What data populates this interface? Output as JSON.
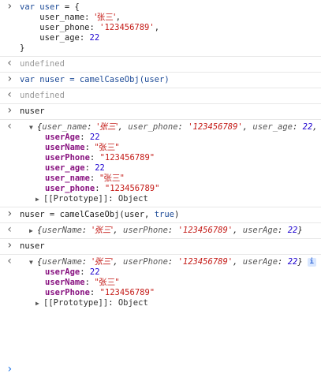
{
  "entries": [
    {
      "type": "input",
      "code_lines": [
        [
          "var ",
          "user",
          " = {"
        ],
        [
          "    user_name: ",
          "'张三'",
          ","
        ],
        [
          "    user_phone: ",
          "'123456789'",
          ","
        ],
        [
          "    user_age: ",
          "22",
          ""
        ],
        [
          "}",
          "",
          ""
        ]
      ]
    },
    {
      "type": "output",
      "text": "undefined"
    },
    {
      "type": "input",
      "kw": "var",
      "text": " nuser = camelCaseObj(user)"
    },
    {
      "type": "output",
      "text": "undefined"
    },
    {
      "type": "input",
      "text": "nuser"
    },
    {
      "type": "output_object",
      "preview": {
        "open": "{",
        "k1": "user_name",
        "v1": "'张三'",
        "k2": "user_phone",
        "v2": "'123456789'",
        "k3": "user_age",
        "v3": "22",
        "tail": ", u"
      },
      "props": [
        {
          "key": "userAge",
          "value": "22",
          "kind": "num"
        },
        {
          "key": "userName",
          "value": "\"张三\"",
          "kind": "str"
        },
        {
          "key": "userPhone",
          "value": "\"123456789\"",
          "kind": "str"
        },
        {
          "key": "user_age",
          "value": "22",
          "kind": "num"
        },
        {
          "key": "user_name",
          "value": "\"张三\"",
          "kind": "str"
        },
        {
          "key": "user_phone",
          "value": "\"123456789\"",
          "kind": "str"
        }
      ],
      "proto_label": "[[Prototype]]",
      "proto_value": "Object"
    },
    {
      "type": "input",
      "text": "nuser = camelCaseObj(user, ",
      "kw_tail": "true",
      "close": ")"
    },
    {
      "type": "output_preview",
      "preview": {
        "k1": "userName",
        "v1": "'张三'",
        "k2": "userPhone",
        "v2": "'123456789'",
        "k3": "userAge",
        "v3": "22"
      }
    },
    {
      "type": "input",
      "text": "nuser"
    },
    {
      "type": "output_object",
      "preview": {
        "k1": "userName",
        "v1": "'张三'",
        "k2": "userPhone",
        "v2": "'123456789'",
        "k3": "userAge",
        "v3": "22"
      },
      "info_badge": "i",
      "props": [
        {
          "key": "userAge",
          "value": "22",
          "kind": "num"
        },
        {
          "key": "userName",
          "value": "\"张三\"",
          "kind": "str"
        },
        {
          "key": "userPhone",
          "value": "\"123456789\"",
          "kind": "str"
        }
      ],
      "proto_label": "[[Prototype]]",
      "proto_value": "Object"
    }
  ],
  "colors": {
    "keyword": "#1c4a97",
    "string": "#c41a16",
    "number": "#1c00cf",
    "undefined": "#9a9a9a",
    "property_key": "#881280",
    "caret": "#1a73e8"
  },
  "icons": {
    "input_prompt": "chevron-right-icon",
    "output_prompt": "chevron-left-icon",
    "expand": "triangle-down-icon",
    "collapsed": "triangle-right-icon",
    "info": "info-icon"
  }
}
